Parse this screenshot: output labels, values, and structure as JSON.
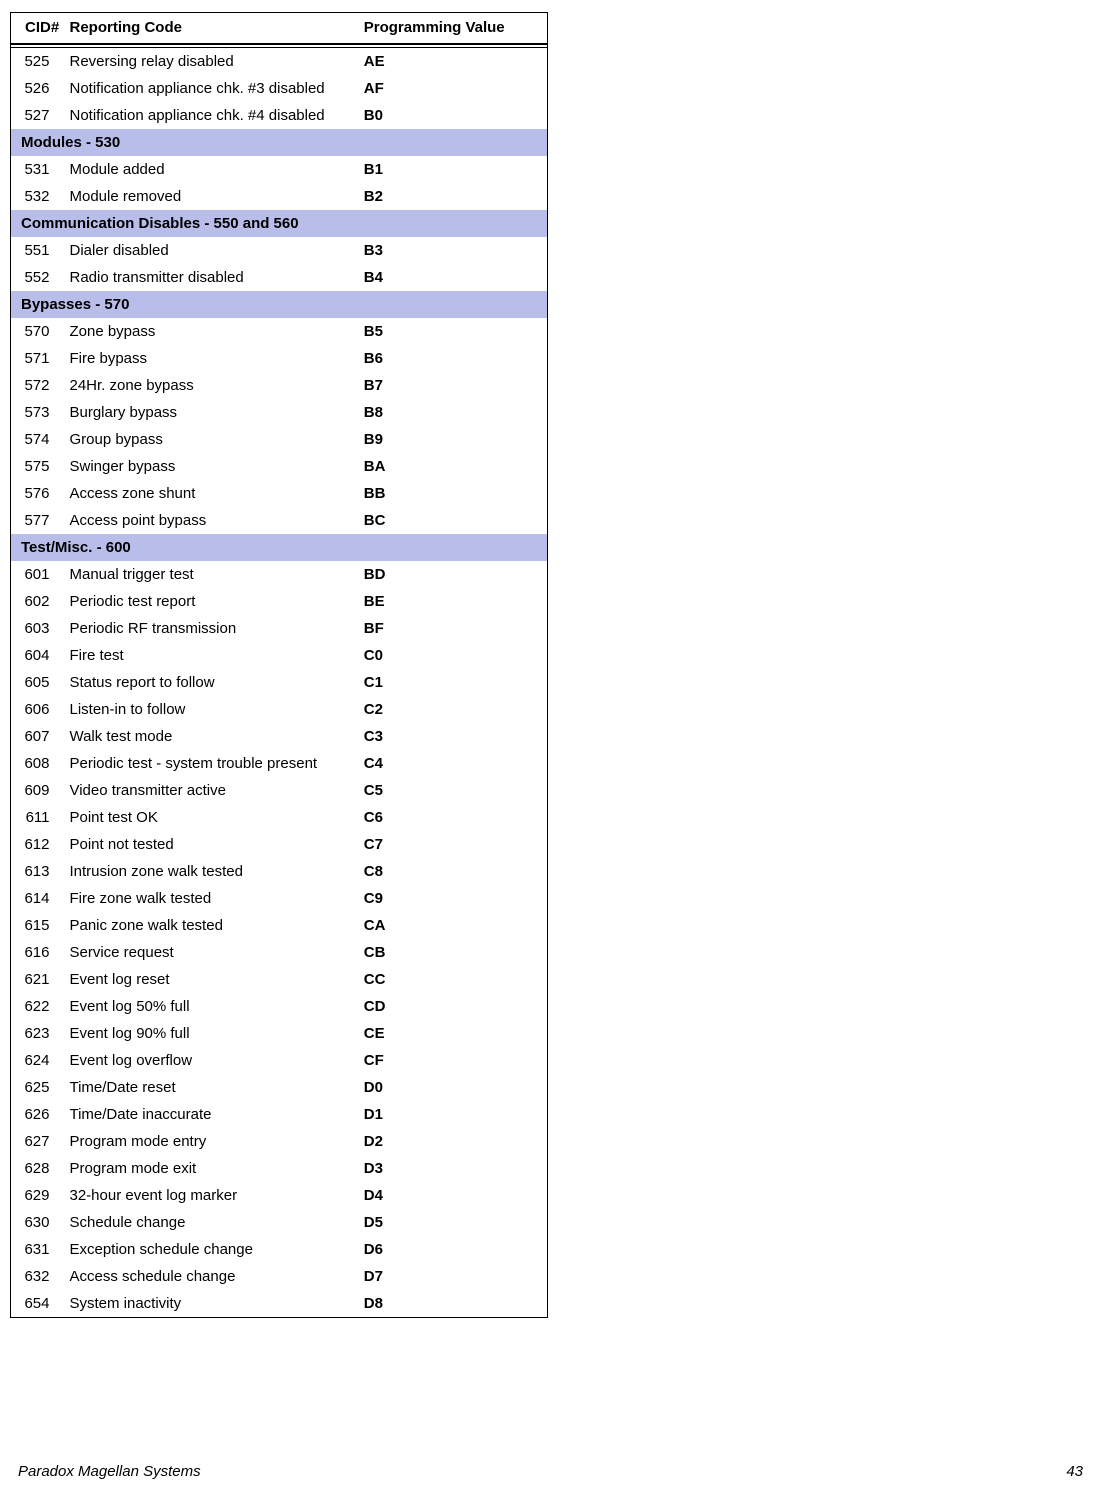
{
  "headers": {
    "cid": "CID#",
    "desc": "Reporting Code",
    "val": "Programming Value"
  },
  "sections": [
    {
      "title": null,
      "rows": [
        {
          "cid": "525",
          "desc": "Reversing relay disabled",
          "val": "AE"
        },
        {
          "cid": "526",
          "desc": "Notification appliance chk. #3 disabled",
          "val": "AF"
        },
        {
          "cid": "527",
          "desc": "Notification appliance chk. #4 disabled",
          "val": "B0"
        }
      ]
    },
    {
      "title": "Modules - 530",
      "rows": [
        {
          "cid": "531",
          "desc": "Module added",
          "val": "B1"
        },
        {
          "cid": "532",
          "desc": "Module removed",
          "val": "B2"
        }
      ]
    },
    {
      "title": "Communication Disables - 550 and 560",
      "rows": [
        {
          "cid": "551",
          "desc": "Dialer disabled",
          "val": "B3"
        },
        {
          "cid": "552",
          "desc": "Radio transmitter disabled",
          "val": "B4"
        }
      ]
    },
    {
      "title": "Bypasses - 570",
      "rows": [
        {
          "cid": "570",
          "desc": "Zone bypass",
          "val": "B5"
        },
        {
          "cid": "571",
          "desc": "Fire bypass",
          "val": "B6"
        },
        {
          "cid": "572",
          "desc": "24Hr. zone bypass",
          "val": "B7"
        },
        {
          "cid": "573",
          "desc": "Burglary bypass",
          "val": "B8"
        },
        {
          "cid": "574",
          "desc": "Group bypass",
          "val": "B9"
        },
        {
          "cid": "575",
          "desc": "Swinger bypass",
          "val": "BA"
        },
        {
          "cid": "576",
          "desc": "Access zone shunt",
          "val": "BB"
        },
        {
          "cid": "577",
          "desc": "Access point bypass",
          "val": "BC"
        }
      ]
    },
    {
      "title": "Test/Misc. - 600",
      "rows": [
        {
          "cid": "601",
          "desc": "Manual trigger test",
          "val": "BD"
        },
        {
          "cid": "602",
          "desc": "Periodic test report",
          "val": "BE"
        },
        {
          "cid": "603",
          "desc": "Periodic RF transmission",
          "val": "BF"
        },
        {
          "cid": "604",
          "desc": "Fire test",
          "val": "C0"
        },
        {
          "cid": "605",
          "desc": "Status report to follow",
          "val": "C1"
        },
        {
          "cid": "606",
          "desc": "Listen-in to follow",
          "val": "C2"
        },
        {
          "cid": "607",
          "desc": "Walk test mode",
          "val": "C3"
        },
        {
          "cid": "608",
          "desc": "Periodic test - system trouble present",
          "val": "C4"
        },
        {
          "cid": "609",
          "desc": "Video transmitter active",
          "val": "C5"
        },
        {
          "cid": "611",
          "desc": "Point test OK",
          "val": "C6"
        },
        {
          "cid": "612",
          "desc": "Point not tested",
          "val": "C7"
        },
        {
          "cid": "613",
          "desc": "Intrusion zone walk tested",
          "val": "C8"
        },
        {
          "cid": "614",
          "desc": "Fire zone walk tested",
          "val": "C9"
        },
        {
          "cid": "615",
          "desc": "Panic zone walk tested",
          "val": "CA"
        },
        {
          "cid": "616",
          "desc": "Service request",
          "val": "CB"
        },
        {
          "cid": "621",
          "desc": "Event log reset",
          "val": "CC"
        },
        {
          "cid": "622",
          "desc": "Event log 50% full",
          "val": "CD"
        },
        {
          "cid": "623",
          "desc": "Event log 90% full",
          "val": "CE"
        },
        {
          "cid": "624",
          "desc": "Event log overflow",
          "val": "CF"
        },
        {
          "cid": "625",
          "desc": "Time/Date reset",
          "val": "D0"
        },
        {
          "cid": "626",
          "desc": "Time/Date inaccurate",
          "val": "D1"
        },
        {
          "cid": "627",
          "desc": "Program mode entry",
          "val": "D2"
        },
        {
          "cid": "628",
          "desc": "Program mode exit",
          "val": "D3"
        },
        {
          "cid": "629",
          "desc": "32-hour event log marker",
          "val": "D4"
        },
        {
          "cid": "630",
          "desc": "Schedule change",
          "val": "D5"
        },
        {
          "cid": "631",
          "desc": "Exception schedule change",
          "val": "D6"
        },
        {
          "cid": "632",
          "desc": "Access schedule change",
          "val": "D7"
        },
        {
          "cid": "654",
          "desc": "System inactivity",
          "val": "D8"
        }
      ]
    }
  ],
  "footer": {
    "left": "Paradox Magellan Systems",
    "right": "43"
  }
}
